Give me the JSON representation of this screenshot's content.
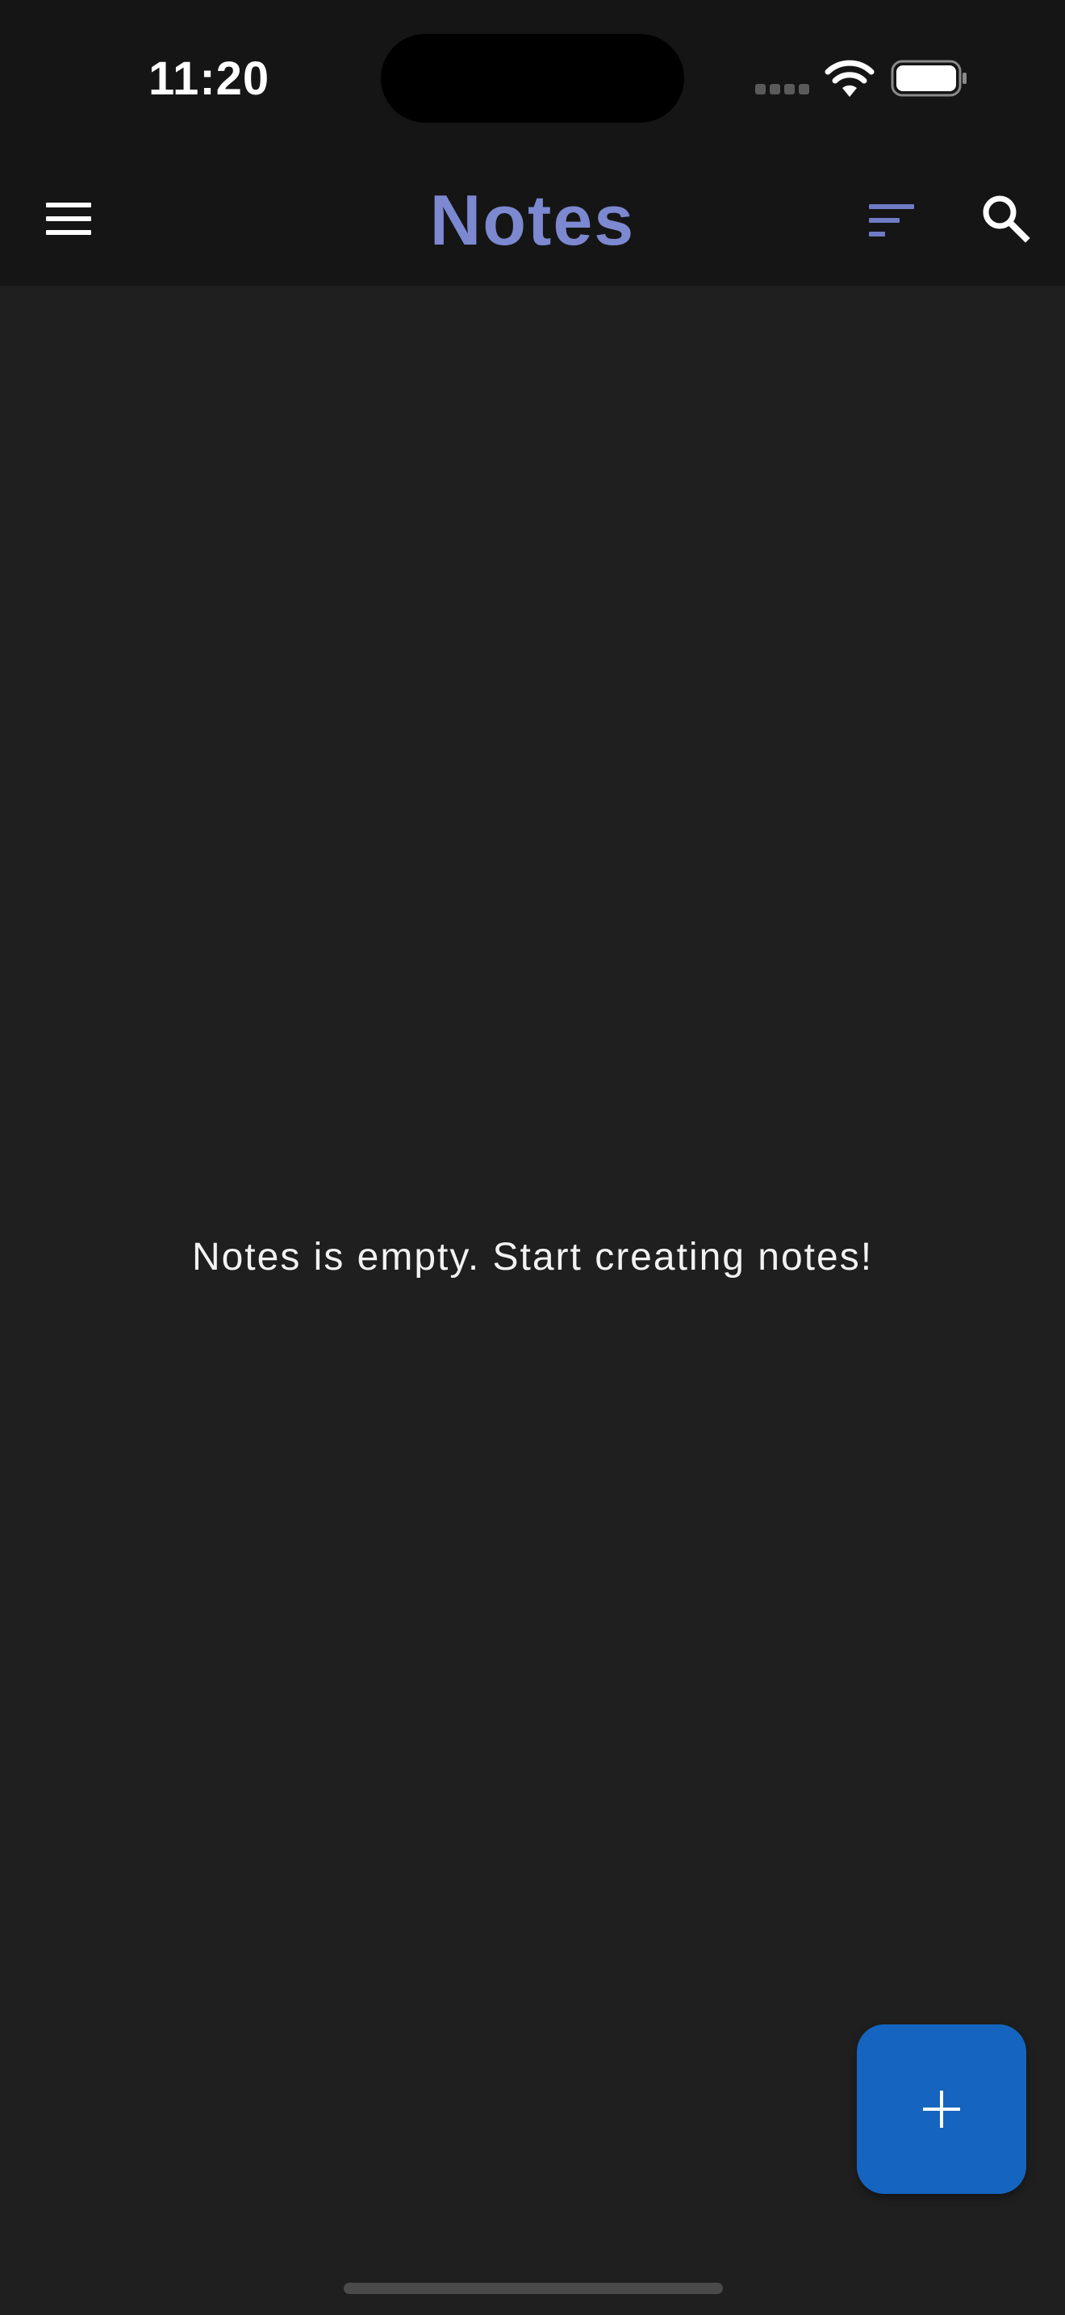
{
  "status_bar": {
    "time": "11:20",
    "icons": [
      "cellular-signal-icon",
      "wifi-icon",
      "battery-icon"
    ]
  },
  "app_bar": {
    "title": "Notes",
    "left_icon": "menu-icon",
    "right_icons": [
      "sort-icon",
      "search-icon"
    ]
  },
  "main": {
    "empty_message": "Notes is empty. Start creating notes!"
  },
  "fab": {
    "icon": "plus-icon"
  },
  "colors": {
    "background": "#1f1f1f",
    "app_bar": "#151515",
    "title": "#7c88cf",
    "sort_icon": "#6f7bc4",
    "fab": "#1565c0",
    "text": "#f2f2f2"
  }
}
